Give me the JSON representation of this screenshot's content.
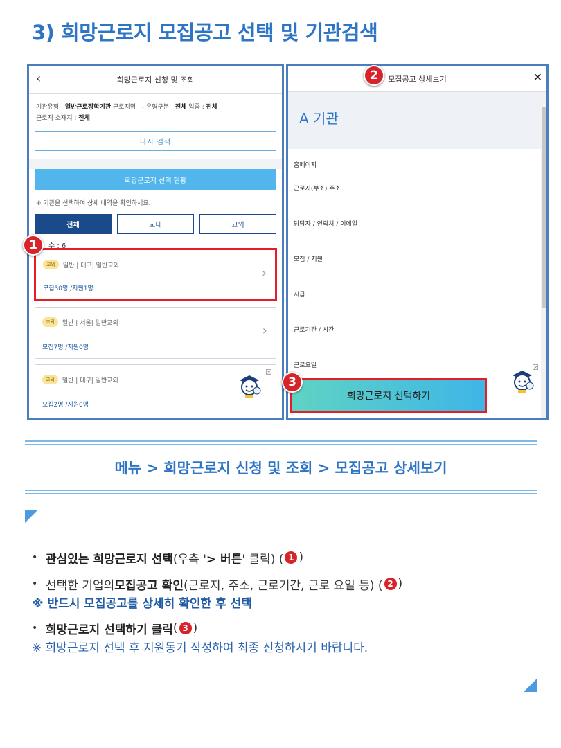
{
  "title": "3) 희망근로지 모집공고 선택 및 기관검색",
  "left": {
    "header": "희망근로지 신청 및 조회",
    "filter_line1_a": "기관유형 : ",
    "filter_line1_b": "일반근로장학기관",
    "filter_line1_c": "  근로지명 : -    유형구분 : ",
    "filter_line1_d": "전체",
    "filter_line1_e": "  업종 : ",
    "filter_line1_f": "전체",
    "filter_line2_a": "근로지 소재지 : ",
    "filter_line2_b": "전체",
    "research_button": "다시 검색",
    "status_button": "희망근로지 선택 현황",
    "notice": "※ 기관을 선택하여 상세 내역을 확인하세요.",
    "tabs": [
      "전체",
      "교내",
      "교외"
    ],
    "count": "수 : 6",
    "cards": [
      {
        "badge": "교외",
        "meta": "일반  |  대구|  일반교외",
        "stat": "모집30명 /지원1명"
      },
      {
        "badge": "교외",
        "meta": "일반  |  서울|  일반교외",
        "stat": "모집7명 /지원0명"
      },
      {
        "badge": "교외",
        "meta": "일반  |  대구|  일반교외",
        "stat": "모집2명 /지원0명"
      }
    ]
  },
  "right": {
    "header": "모집공고 상세보기",
    "org": "A 기관",
    "fields": [
      "홈페이지",
      "근로지(부소) 주소",
      "담당자 / 연락처 / 이메일",
      "모집 / 지원",
      "시급",
      "근로기간 / 시간",
      "근로요일"
    ],
    "select_button": "희망근로지 선택하기"
  },
  "markers": [
    "1",
    "2",
    "3"
  ],
  "menu_path": "메뉴 > 희망근로지 신청 및 조회 > 모집공고 상세보기",
  "bullets": {
    "b1_bold": "관심있는 희망근로지 선택",
    "b1_rest_a": " (우측 '",
    "b1_rest_b": "> 버튼",
    "b1_rest_c": "' 클릭) (",
    "b1_end": " )",
    "b2_a": "선택한 기업의 ",
    "b2_bold": "모집공고 확인",
    "b2_b": "(근로지, 주소, 근로기간, 근로 요일 등) (",
    "b2_end": ")",
    "note1": "※  반드시 모집공고를 상세히 확인한 후 선택",
    "b3_bold": "희망근로지 선택하기 클릭",
    "b3_a": "(",
    "b3_end": " )",
    "note2": "※  희망근로지 선택 후 지원동기 작성하여 최종 신청하시기 바랍니다."
  },
  "colors": {
    "accent": "#2e75c6",
    "marker": "#d7242b",
    "highlight": "#e41e26"
  }
}
